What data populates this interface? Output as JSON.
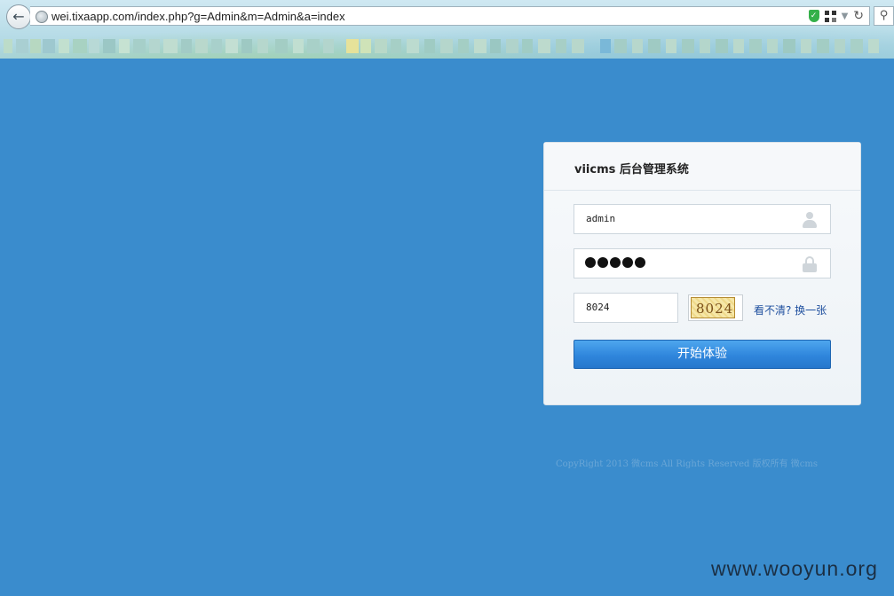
{
  "browser": {
    "url": "wei.tixaapp.com/index.php?g=Admin&m=Admin&a=index"
  },
  "login": {
    "title": "viicms 后台管理系统",
    "username_value": "admin",
    "password_dot_count": 5,
    "captcha_value": "8024",
    "captcha_image_text": "8024",
    "refresh_link": "看不清? 换一张",
    "submit_label": "开始体验"
  },
  "footer": {
    "copyright": "CopyRight 2013 微cms All Rights Reserved 版权所有 微cms"
  },
  "watermark": "www.wooyun.org",
  "colors": {
    "page_background": "#3a8ccd",
    "button": "#2f86dc",
    "link": "#1f4f9e"
  }
}
